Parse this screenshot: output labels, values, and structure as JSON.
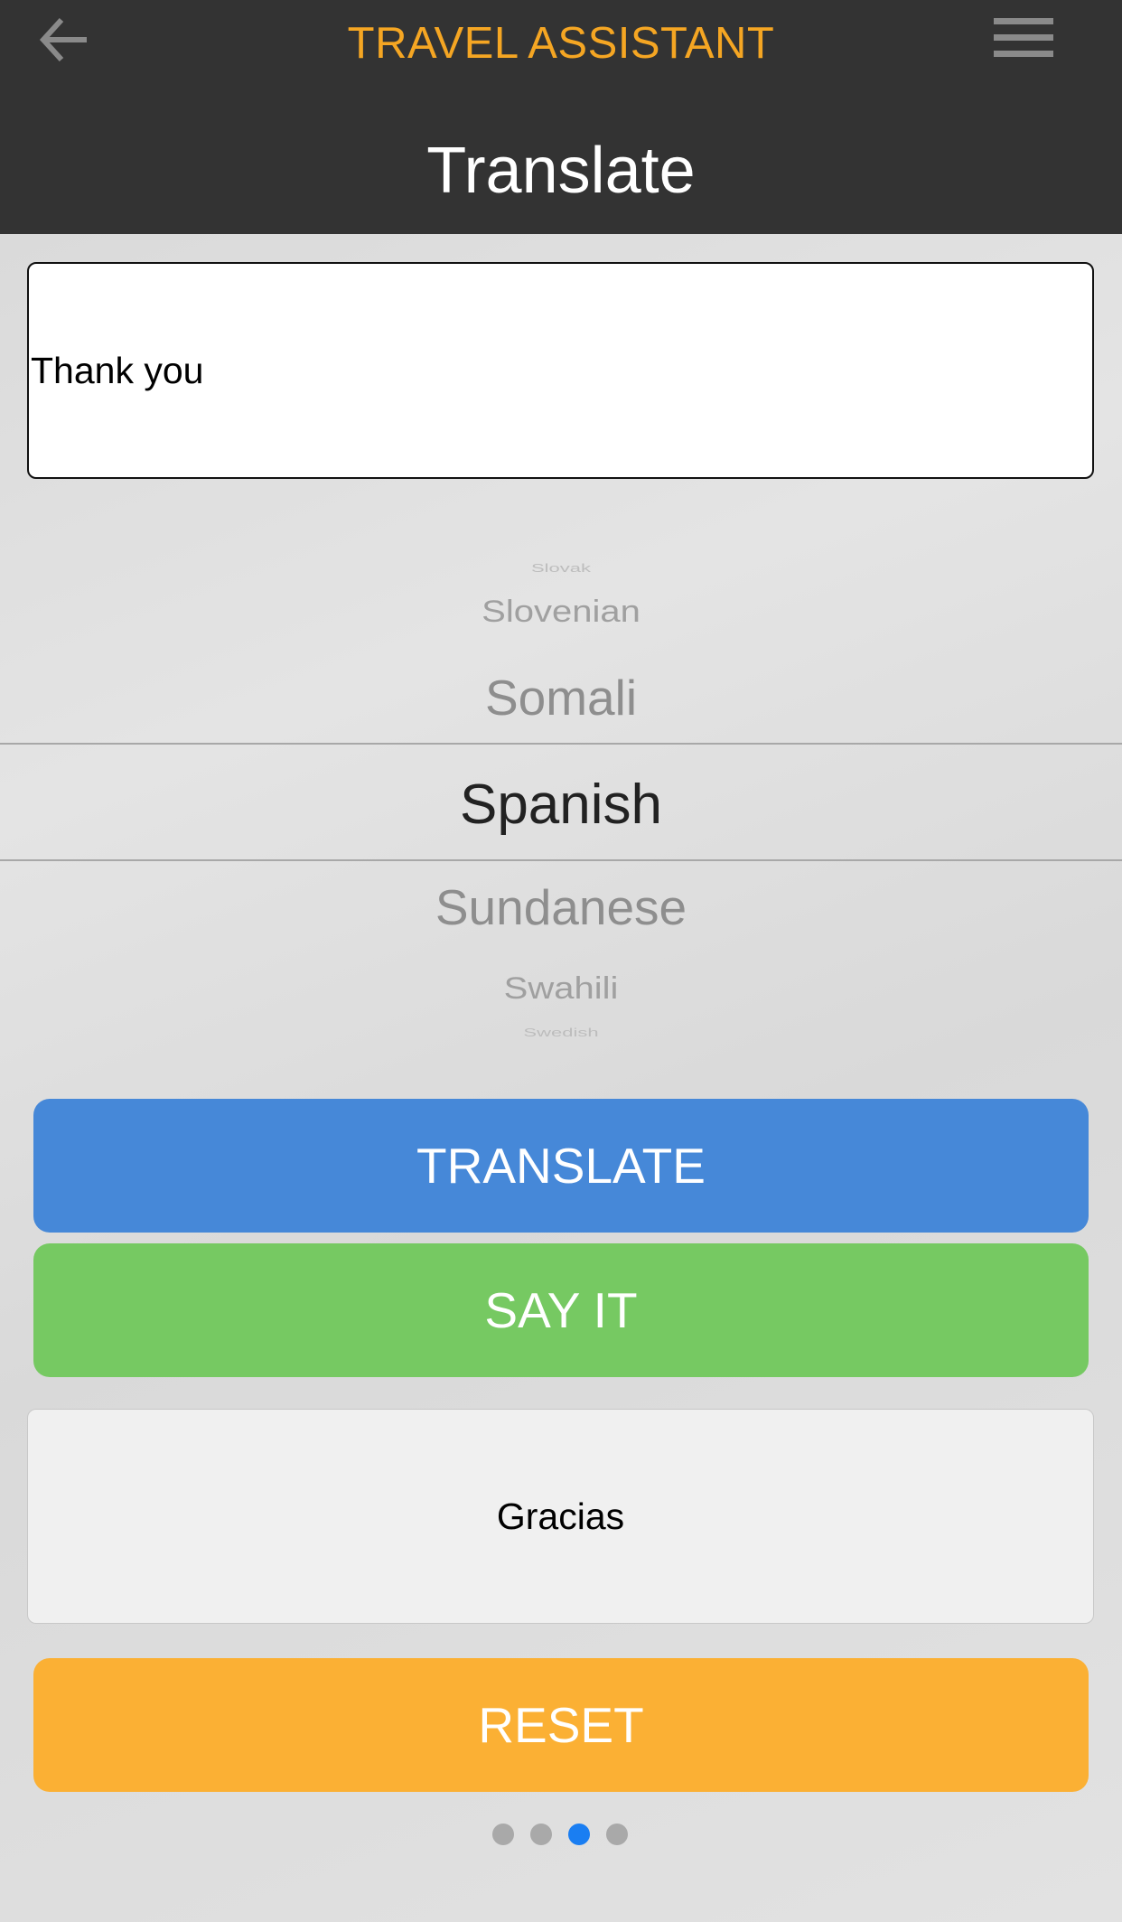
{
  "header": {
    "app_title": "TRAVEL ASSISTANT",
    "page_title": "Translate",
    "back_icon": "arrow-left-icon",
    "menu_icon": "hamburger-menu-icon"
  },
  "input": {
    "value": "Thank you"
  },
  "language_picker": {
    "items": [
      "Slovak",
      "Slovenian",
      "Somali",
      "Spanish",
      "Sundanese",
      "Swahili",
      "Swedish"
    ],
    "selected": "Spanish"
  },
  "buttons": {
    "translate": "TRANSLATE",
    "say_it": "SAY IT",
    "reset": "RESET"
  },
  "output": {
    "value": "Gracias"
  },
  "pagination": {
    "total": 4,
    "current": 3
  },
  "colors": {
    "header": "#333333",
    "accent": "#f5a623",
    "translate": "#4688d8",
    "say_it": "#76c962",
    "reset": "#fbb034",
    "active_dot": "#1a7ef2"
  }
}
